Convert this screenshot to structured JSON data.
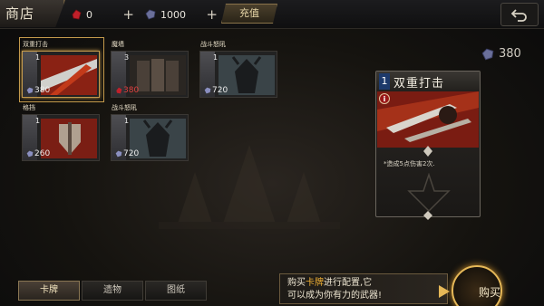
{
  "header": {
    "shop_title": "商店",
    "blood_count": "0",
    "gem_count": "1000",
    "recharge_label": "充值",
    "plus": "+"
  },
  "cards": [
    {
      "name": "双重打击",
      "level": "1",
      "cost": "380",
      "cost_affordable": true,
      "selected": true,
      "art": "red-slash"
    },
    {
      "name": "魔墙",
      "level": "3",
      "cost": "380",
      "cost_affordable": false,
      "selected": false,
      "art": "dark-wall"
    },
    {
      "name": "战斗怒吼",
      "level": "1",
      "cost": "720",
      "cost_affordable": true,
      "selected": false,
      "art": "warrior-helm"
    },
    {
      "name": "格挡",
      "level": "1",
      "cost": "260",
      "cost_affordable": true,
      "selected": false,
      "art": "red-shield"
    },
    {
      "name": "战斗怒吼",
      "level": "1",
      "cost": "720",
      "cost_affordable": true,
      "selected": false,
      "art": "warrior-helm"
    }
  ],
  "detail": {
    "price": "380",
    "level": "1",
    "title": "双重打击",
    "description": "*造成5点伤害2次."
  },
  "tabs": [
    {
      "label": "卡牌",
      "active": true
    },
    {
      "label": "遗物",
      "active": false
    },
    {
      "label": "图纸",
      "active": false
    }
  ],
  "tip": {
    "line1_prefix": "购买",
    "line1_highlight": "卡牌",
    "line1_suffix": "进行配置,它",
    "line2": "可以成为你有力的武器!"
  },
  "buy_label": "购买",
  "colors": {
    "gold": "#c49a4c",
    "accent_orange": "#f0b034",
    "cost_red": "#e04040"
  }
}
